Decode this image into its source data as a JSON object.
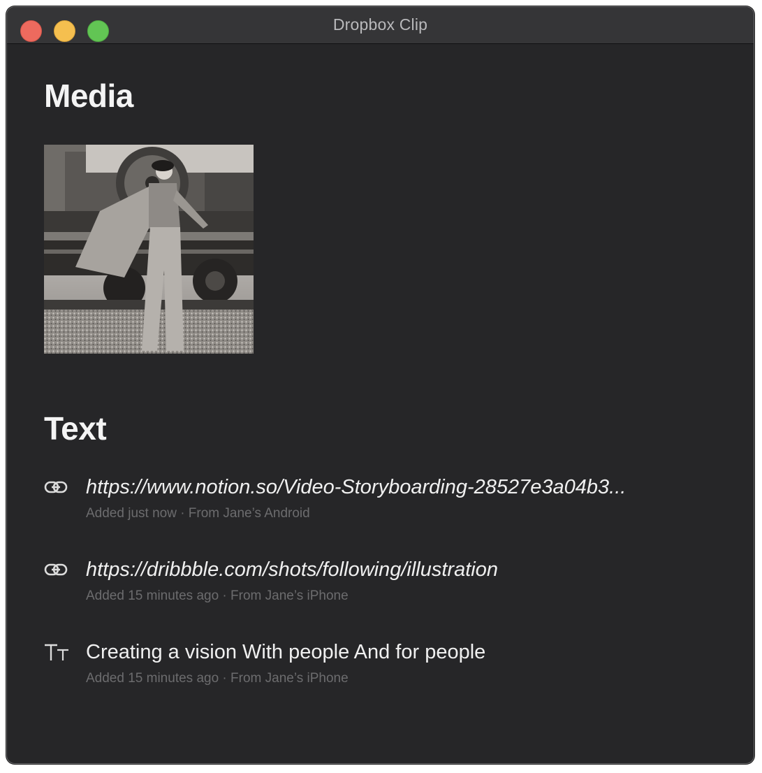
{
  "window": {
    "title": "Dropbox Clip"
  },
  "sections": {
    "media": {
      "heading": "Media"
    },
    "text": {
      "heading": "Text"
    }
  },
  "items": [
    {
      "type": "link",
      "icon": "link-icon",
      "title": "https://www.notion.so/Video-Storyboarding-28527e3a04b3...",
      "meta": "Added just now · From Jane’s Android"
    },
    {
      "type": "link",
      "icon": "link-icon",
      "title": "https://dribbble.com/shots/following/illustration",
      "meta": "Added 15 minutes ago · From Jane’s iPhone"
    },
    {
      "type": "text",
      "icon": "text-format-icon",
      "title": "Creating a vision With people And for people",
      "meta": "Added 15 minutes ago · From Jane’s iPhone"
    }
  ],
  "colors": {
    "background": "#262628",
    "titlebar": "#353537",
    "close": "#ed6a5e",
    "minimize": "#f5bf4f",
    "zoom": "#62c554",
    "meta_text": "#6c6c6e"
  }
}
